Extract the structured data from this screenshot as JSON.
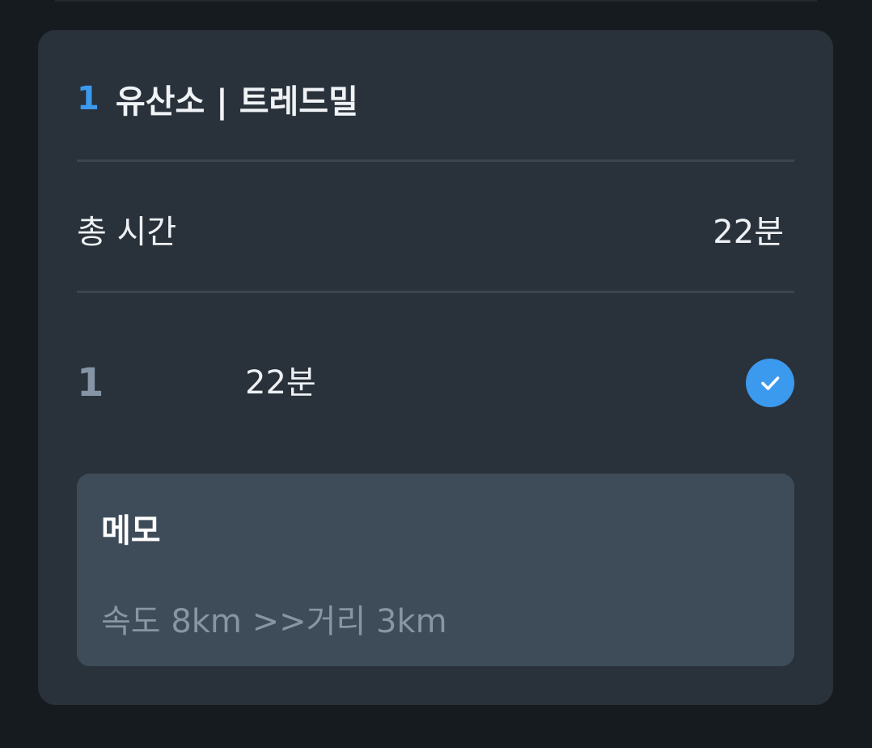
{
  "exercise": {
    "index": "1",
    "title": "유산소 | 트레드밀"
  },
  "total": {
    "label": "총 시간",
    "value": "22분"
  },
  "sets": [
    {
      "number": "1",
      "time": "22분",
      "completed": true,
      "icon": "check-icon"
    }
  ],
  "memo": {
    "label": "메모",
    "text": "속도 8km >>거리 3km"
  },
  "colors": {
    "accent": "#3b99ee",
    "card": "#29313a",
    "memo_bg": "#3e4c59",
    "background": "#161b20"
  }
}
